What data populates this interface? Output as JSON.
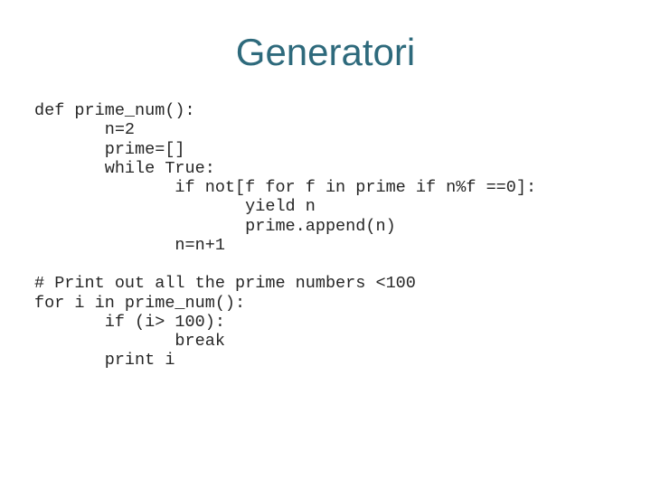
{
  "slide": {
    "title": "Generatori",
    "code": "def prime_num():\n       n=2\n       prime=[]\n       while True:\n              if not[f for f in prime if n%f ==0]:\n                     yield n\n                     prime.append(n)\n              n=n+1\n\n# Print out all the prime numbers <100\nfor i in prime_num():\n       if (i> 100):\n              break\n       print i"
  }
}
